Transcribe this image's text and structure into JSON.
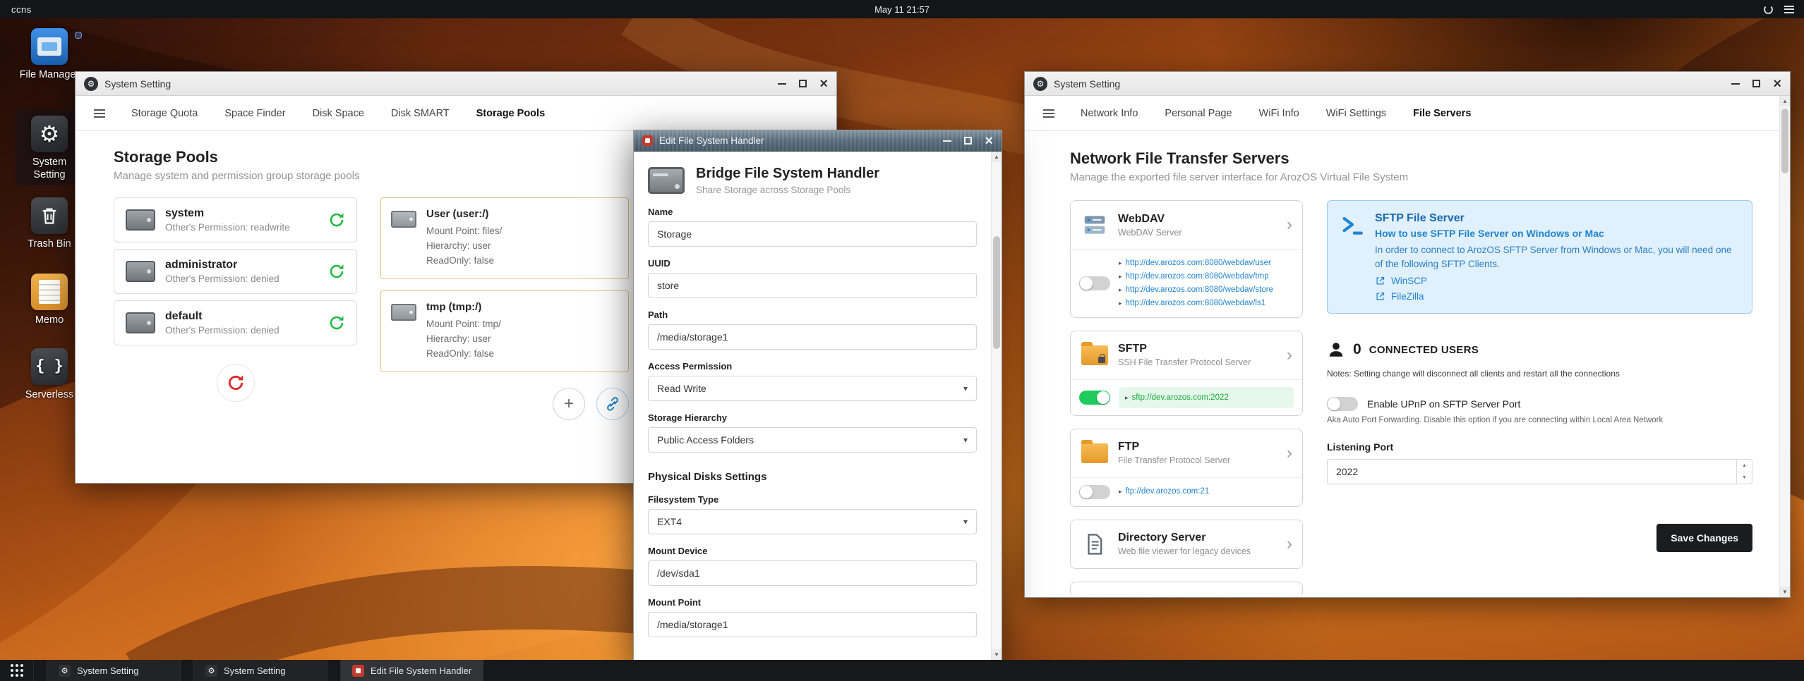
{
  "colors": {
    "accent_green": "#21ba45",
    "link_blue": "#2185d0",
    "danger_red": "#db2828",
    "dark": "#1b1c1d"
  },
  "topbar": {
    "host": "ccns",
    "clock": "May 11 21:57"
  },
  "desktop": {
    "icons": [
      {
        "label": "File Manager"
      },
      {
        "label": "System Setting"
      },
      {
        "label": "Trash Bin"
      },
      {
        "label": "Memo"
      },
      {
        "label": "Serverless"
      }
    ]
  },
  "storage_window": {
    "title": "System Setting",
    "tabs": [
      {
        "label": "Storage Quota"
      },
      {
        "label": "Space Finder"
      },
      {
        "label": "Disk Space"
      },
      {
        "label": "Disk SMART"
      },
      {
        "label": "Storage Pools"
      }
    ],
    "heading": "Storage Pools",
    "subheading": "Manage system and permission group storage pools",
    "pools": [
      {
        "name": "system",
        "permission": "Other's Permission: readwrite"
      },
      {
        "name": "administrator",
        "permission": "Other's Permission: denied"
      },
      {
        "name": "default",
        "permission": "Other's Permission: denied"
      }
    ],
    "mounts": [
      {
        "name": "User (user:/)",
        "mount_point": "Mount Point: files/",
        "hierarchy": "Hierarchy: user",
        "readonly": "ReadOnly: false"
      },
      {
        "name": "tmp (tmp:/)",
        "mount_point": "Mount Point: tmp/",
        "hierarchy": "Hierarchy: user",
        "readonly": "ReadOnly: false"
      }
    ]
  },
  "edit_window": {
    "title": "Edit File System Handler",
    "heading": "Bridge File System Handler",
    "subheading": "Share Storage across Storage Pools",
    "section_heading": "Physical Disks Settings",
    "fields": {
      "name": {
        "label": "Name",
        "value": "Storage"
      },
      "uuid": {
        "label": "UUID",
        "value": "store"
      },
      "path": {
        "label": "Path",
        "value": "/media/storage1"
      },
      "access": {
        "label": "Access Permission",
        "value": "Read Write"
      },
      "hierarchy": {
        "label": "Storage Hierarchy",
        "value": "Public Access Folders"
      },
      "fstype": {
        "label": "Filesystem Type",
        "value": "EXT4"
      },
      "mount_device": {
        "label": "Mount Device",
        "value": "/dev/sda1"
      },
      "mount_point": {
        "label": "Mount Point",
        "value": "/media/storage1"
      }
    }
  },
  "servers_window": {
    "title": "System Setting",
    "tabs": [
      {
        "label": "Network Info"
      },
      {
        "label": "Personal Page"
      },
      {
        "label": "WiFi Info"
      },
      {
        "label": "WiFi Settings"
      },
      {
        "label": "File Servers"
      }
    ],
    "heading": "Network File Transfer Servers",
    "subheading": "Manage the exported file server interface for ArozOS Virtual File System",
    "webdav": {
      "name": "WebDAV",
      "desc": "WebDAV Server",
      "links": [
        {
          "url": "http://dev.arozos.com:8080/webdav/user"
        },
        {
          "url": "http://dev.arozos.com:8080/webdav/tmp"
        },
        {
          "url": "http://dev.arozos.com:8080/webdav/store"
        },
        {
          "url": "http://dev.arozos.com:8080/webdav/ls1"
        }
      ]
    },
    "sftp": {
      "name": "SFTP",
      "desc": "SSH File Transfer Protocol Server",
      "link": "sftp://dev.arozos.com:2022"
    },
    "ftp": {
      "name": "FTP",
      "desc": "File Transfer Protocol Server",
      "link": "ftp://dev.arozos.com:21"
    },
    "directory": {
      "name": "Directory Server",
      "desc": "Web file viewer for legacy devices"
    },
    "sftp_help": {
      "title": "SFTP File Server",
      "subtitle": "How to use SFTP File Server on Windows or Mac",
      "body": "In order to connect to ArozOS SFTP Server from Windows or Mac, you will need one of the following SFTP Clients.",
      "clients": [
        {
          "name": "WinSCP"
        },
        {
          "name": "FileZilla"
        }
      ]
    },
    "connected": {
      "count": "0",
      "label": "CONNECTED USERS",
      "note": "Notes: Setting change will disconnect all clients and restart all the connections"
    },
    "upnp": {
      "label": "Enable UPnP on SFTP Server Port",
      "note": "Aka Auto Port Forwarding. Disable this option if you are connecting within Local Area Network"
    },
    "listening_port": {
      "label": "Listening Port",
      "value": "2022"
    },
    "save_label": "Save Changes"
  },
  "taskbar": {
    "items": [
      {
        "label": "System Setting"
      },
      {
        "label": "System Setting"
      },
      {
        "label": "Edit File System Handler"
      }
    ]
  }
}
